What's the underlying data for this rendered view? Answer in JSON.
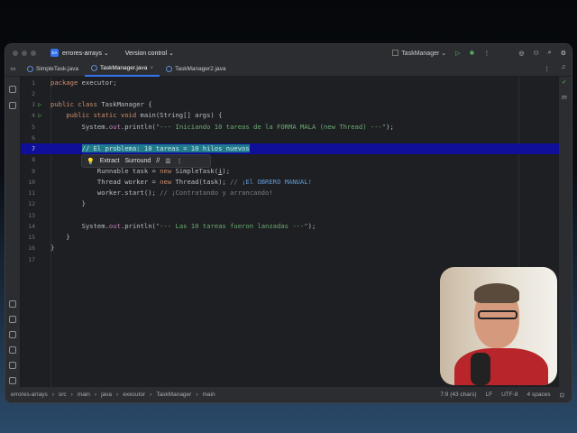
{
  "titlebar": {
    "project_badge": "EA",
    "project": "errores-arrays ⌄",
    "vcs": "Version control ⌄",
    "run_config": "TaskManager ⌄"
  },
  "tabs": [
    {
      "label": "SimpleTask.java"
    },
    {
      "label": "TaskManager.java",
      "close": "×"
    },
    {
      "label": "TaskManager2.java"
    }
  ],
  "editor": {
    "lines": [
      {
        "n": "1",
        "html": "<span class=\"kw\">package</span> executor;"
      },
      {
        "n": "2",
        "html": ""
      },
      {
        "n": "3",
        "html": "<span class=\"kw\">public class</span> TaskManager {"
      },
      {
        "n": "4",
        "html": "    <span class=\"kw\">public static void</span> main(String[] args) {"
      },
      {
        "n": "5",
        "html": "        System.<span class=\"fld\">out</span>.println(<span class=\"str\">\"--- Iniciando 10 tareas de la FORMA MALA (new Thread) ---\"</span>);"
      },
      {
        "n": "6",
        "html": ""
      },
      {
        "n": "7",
        "html": "        <span class=\"sel\">// El problema: 10 tareas = 10 hilos nuevos</span>"
      },
      {
        "n": "8",
        "html": "                             {"
      },
      {
        "n": "9",
        "html": "            Runnable task = <span class=\"kw\">new</span> SimpleTask(<u>i</u>);"
      },
      {
        "n": "10",
        "html": "            Thread worker = <span class=\"kw\">new</span> Thread(task); <span class=\"cm\">// </span><span class=\"cmi\">¡El OBRERO MANUAL!</span>"
      },
      {
        "n": "11",
        "html": "            worker.start(); <span class=\"cm\">// ¡Contratando y arrancando!</span>"
      },
      {
        "n": "12",
        "html": "        }"
      },
      {
        "n": "13",
        "html": ""
      },
      {
        "n": "14",
        "html": "        System.<span class=\"fld\">out</span>.println(<span class=\"str\">\"--- Las 10 tareas fueron lanzadas ---\"</span>);"
      },
      {
        "n": "15",
        "html": "    }"
      },
      {
        "n": "16",
        "html": "}"
      },
      {
        "n": "17",
        "html": ""
      }
    ],
    "popup": {
      "extract": "Extract",
      "surround": "Surround",
      "comment": "//"
    }
  },
  "status": {
    "crumbs": [
      "errores-arrays",
      "src",
      "main",
      "java",
      "executor",
      "TaskManager",
      "main"
    ],
    "position": "7:9 (43 chars)",
    "line_sep": "LF",
    "encoding": "UTF-8",
    "indent": "4 spaces"
  }
}
